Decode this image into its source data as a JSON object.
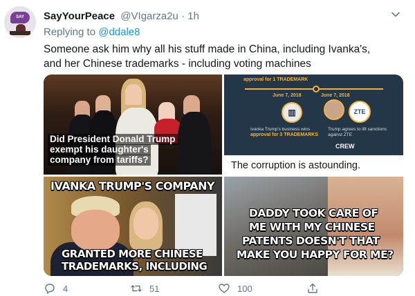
{
  "tweet": {
    "display_name": "SayYourPeace",
    "handle": "@VIgarza2u",
    "separator": "·",
    "time": "1h",
    "replying_prefix": "Replying to",
    "replying_to": "@ddale8",
    "text_line1": "Someone ask him why all his stuff made in China, including Ivanka's,",
    "text_line2": "and her Chinese trademarks - including voting machines",
    "avatar_badge": "SAY YOUR"
  },
  "media": {
    "image1": {
      "line1": "Did President Donald Trump",
      "line2": "exempt his daughter's",
      "line3": "company from tariffs?"
    },
    "image2": {
      "top_text": "approval for 1 TRADEMARK",
      "date_left": "June 7, 2018",
      "date_right": "June 7, 2018",
      "left_caption_1": "Ivanka Trump's business wins",
      "left_caption_2": "approval for 3 TRADEMARKS",
      "right_caption_1": "Trump agrees to lift sanctions",
      "right_caption_2": "against ZTE",
      "logo_right": "ZTE",
      "brand": "CREW",
      "caption": "The corruption is astounding."
    },
    "image3": {
      "top": "IVANKA TRUMP'S COMPANY",
      "bottom1": "GRANTED MORE CHINESE",
      "bottom2": "TRADEMARKS, INCLUDING"
    },
    "image4": {
      "line1": "DADDY TOOK CARE OF",
      "line2": "ME WITH MY CHINESE",
      "line3": "PATENTS DOESN'T THAT",
      "line4": "MAKE YOU HAPPY FOR ME?"
    }
  },
  "actions": {
    "reply_count": "4",
    "retweet_count": "51",
    "like_count": "100"
  }
}
